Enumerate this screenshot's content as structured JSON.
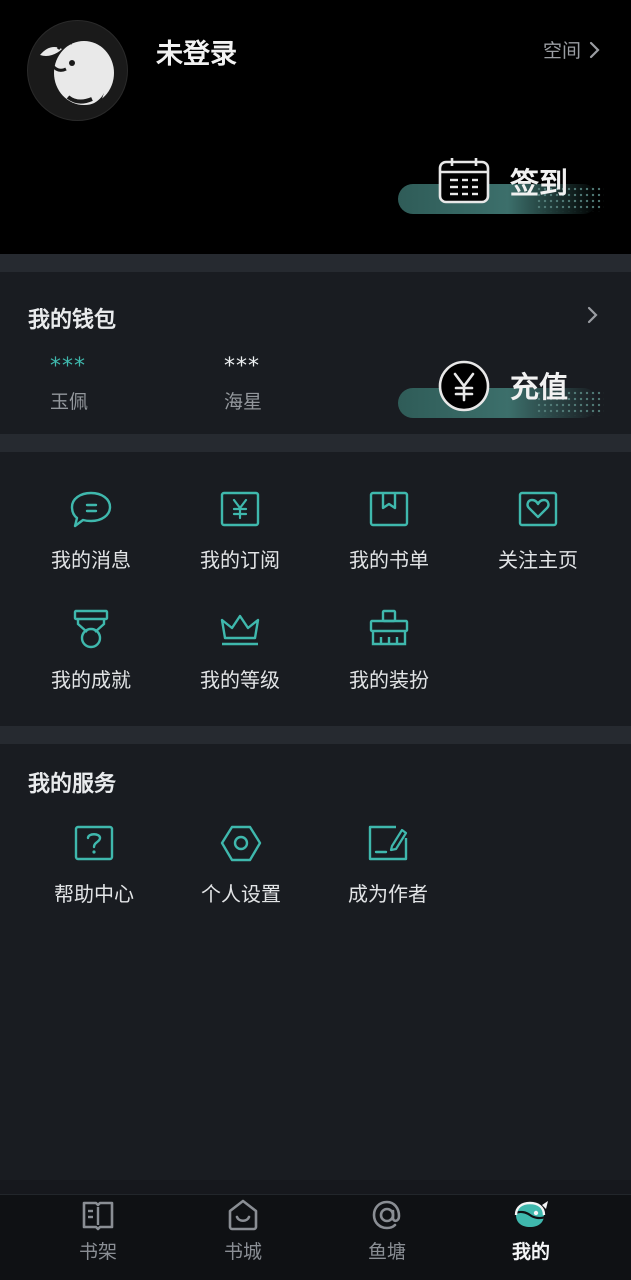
{
  "header": {
    "username": "未登录",
    "space_label": "空间",
    "checkin_label": "签到"
  },
  "wallet": {
    "title": "我的钱包",
    "recharge_label": "充值",
    "balances": [
      {
        "value": "***",
        "label": "玉佩",
        "color": "#3fb8ad"
      },
      {
        "value": "***",
        "label": "海星",
        "color": "#eceff1"
      }
    ]
  },
  "features": {
    "items": [
      {
        "label": "我的消息",
        "icon": "chat-bubble-icon"
      },
      {
        "label": "我的订阅",
        "icon": "yen-subscription-icon"
      },
      {
        "label": "我的书单",
        "icon": "book-bookmark-icon"
      },
      {
        "label": "关注主页",
        "icon": "heart-card-icon"
      },
      {
        "label": "我的成就",
        "icon": "medal-icon"
      },
      {
        "label": "我的等级",
        "icon": "crown-icon"
      },
      {
        "label": "我的装扮",
        "icon": "brush-icon"
      }
    ]
  },
  "services": {
    "title": "我的服务",
    "items": [
      {
        "label": "帮助中心",
        "icon": "help-icon"
      },
      {
        "label": "个人设置",
        "icon": "settings-hex-icon"
      },
      {
        "label": "成为作者",
        "icon": "write-icon"
      }
    ]
  },
  "nav": {
    "items": [
      {
        "label": "书架",
        "icon": "bookshelf-icon",
        "active": false
      },
      {
        "label": "书城",
        "icon": "bookstore-icon",
        "active": false
      },
      {
        "label": "鱼塘",
        "icon": "fishpond-icon",
        "active": false
      },
      {
        "label": "我的",
        "icon": "profile-icon",
        "active": true
      }
    ]
  },
  "colors": {
    "accent": "#3fb8ad",
    "background": "#191c21",
    "header": "#000000"
  }
}
